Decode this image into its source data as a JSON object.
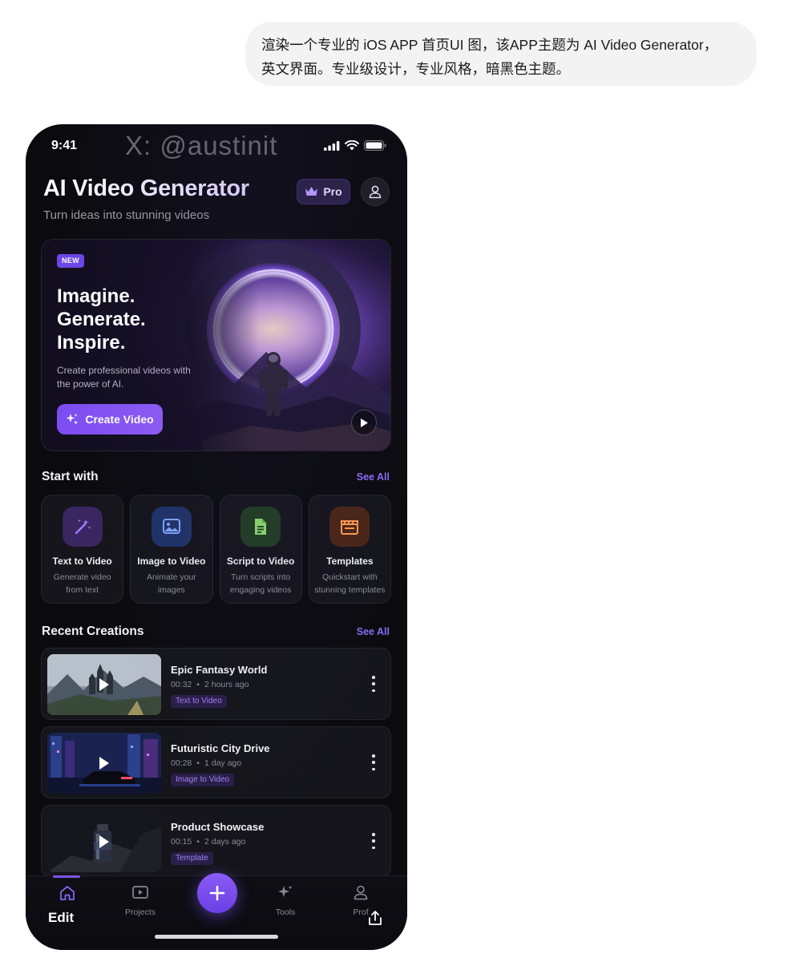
{
  "prompt": {
    "line1": "渲染一个专业的 iOS APP 首页UI 图，该APP主题为 AI Video Generator，",
    "line2": "英文界面。专业级设计，专业风格，暗黑色主题。"
  },
  "status_bar": {
    "time": "9:41",
    "watermark": "X: @austinit"
  },
  "header": {
    "title": "AI Video Generator",
    "subtitle": "Turn ideas into stunning videos",
    "pro_label": "Pro"
  },
  "hero": {
    "badge": "NEW",
    "headline": [
      "Imagine.",
      "Generate.",
      "Inspire."
    ],
    "description": "Create professional videos with the power of AI.",
    "cta_label": "Create Video"
  },
  "start_with": {
    "title": "Start with",
    "see_all": "See All",
    "cards": [
      {
        "title": "Text to Video",
        "desc": "Generate video from text",
        "icon": "magic-wand-icon",
        "color": "#a67cff",
        "bg": "#3a2660"
      },
      {
        "title": "Image to Video",
        "desc": "Animate your images",
        "icon": "image-icon",
        "color": "#7ea6ff",
        "bg": "#1f3366"
      },
      {
        "title": "Script to Video",
        "desc": "Turn scripts into engaging videos",
        "icon": "document-icon",
        "color": "#8ad66a",
        "bg": "#213d22"
      },
      {
        "title": "Templates",
        "desc": "Quickstart with stunning templates",
        "icon": "clapperboard-icon",
        "color": "#ff9a52",
        "bg": "#4a2616"
      }
    ]
  },
  "recent": {
    "title": "Recent Creations",
    "see_all": "See All",
    "items": [
      {
        "title": "Epic Fantasy World",
        "duration": "00:32",
        "time": "2 hours ago",
        "tag": "Text to Video"
      },
      {
        "title": "Futuristic City Drive",
        "duration": "00:28",
        "time": "1 day ago",
        "tag": "Image to Video"
      },
      {
        "title": "Product Showcase",
        "duration": "00:15",
        "time": "2 days ago",
        "tag": "Template"
      }
    ]
  },
  "tab_bar": {
    "tabs": [
      {
        "label": "Home",
        "active": true
      },
      {
        "label": "Projects"
      },
      {
        "label": "Tools"
      },
      {
        "label": "Prof"
      }
    ],
    "edit_label": "Edit"
  },
  "colors": {
    "accent": "#7b4cf0",
    "background": "#0b0b0f",
    "card": "#15151b"
  }
}
